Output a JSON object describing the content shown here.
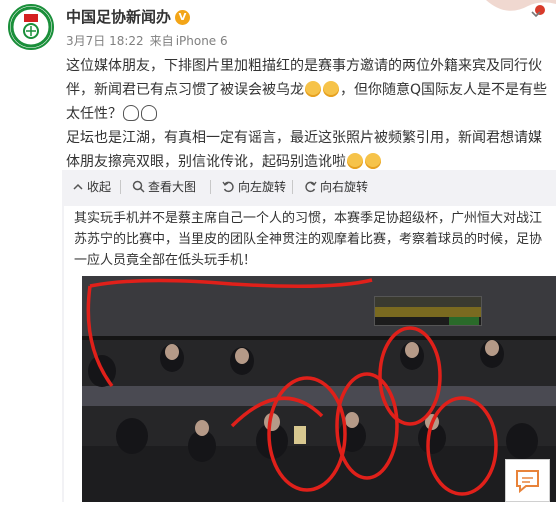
{
  "author": {
    "name": "中国足协新闻办",
    "verified_badge": "V"
  },
  "meta": {
    "date": "3月7日 18:22",
    "source_prefix": "来自",
    "source": "iPhone 6"
  },
  "post": {
    "p1_a": "这位媒体朋友，下排图片里加粗描红的是赛事方邀请的两位外籍来宾及同行伙伴，新闻君已有点习惯了被误会被乌龙",
    "p1_b": "，但你随意Q国际友人是不是有些太任性？",
    "p2_a": "足坛也是江湖，有真相一定有谣言，最近这张照片被频繁引用，新闻君想请媒体朋友擦亮双眼，别信讹传讹，起码别造讹啦",
    "emoticons": [
      "tears-emoticon",
      "tears-emoticon",
      "panda-emoticon",
      "panda-emoticon",
      "pray-emoticon",
      "pray-emoticon"
    ]
  },
  "toolbar": {
    "collapse": "收起",
    "view_large": "查看大图",
    "rotate_left": "向左旋转",
    "rotate_right": "向右旋转"
  },
  "screenshot": {
    "caption": "其实玩手机并不是蔡主席自己一个人的习惯，本赛季足协超级杯，广州恒大对战江苏苏宁的比赛中，当里皮的团队全神贯注的观摩着比赛，考察着球员的时候，足协一应人员竟全部在低头玩手机！"
  },
  "colors": {
    "highlight_circle": "#e0201a",
    "toolbar_bg": "#f2f2f5",
    "brand_green": "#1a8f3a"
  }
}
